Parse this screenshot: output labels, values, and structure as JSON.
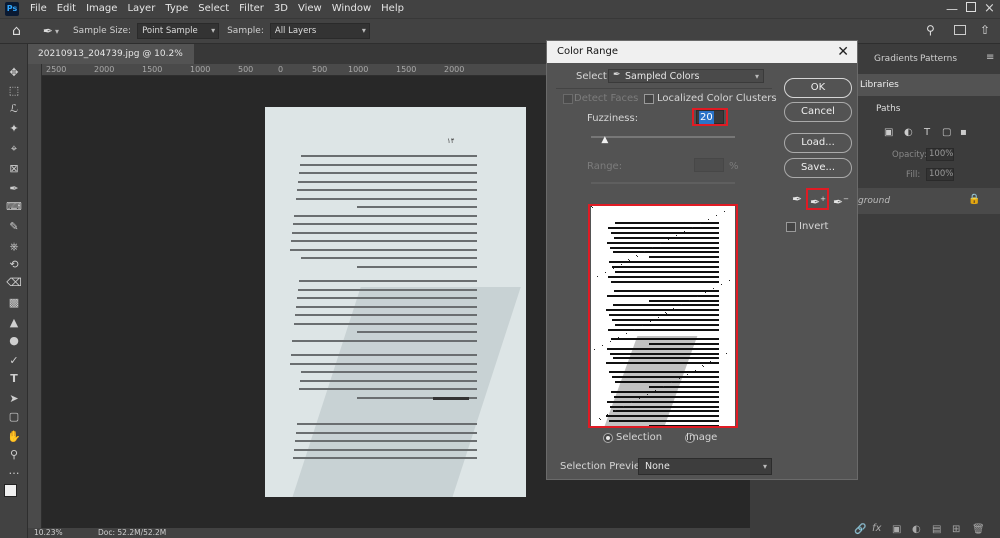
{
  "menubar": {
    "logo": "Ps",
    "items": [
      "File",
      "Edit",
      "Image",
      "Layer",
      "Type",
      "Select",
      "Filter",
      "3D",
      "View",
      "Window",
      "Help"
    ]
  },
  "options_bar": {
    "sample_size_label": "Sample Size:",
    "sample_size_value": "Point Sample",
    "sample_label": "Sample:",
    "sample_value": "All Layers"
  },
  "document": {
    "tab_title": "20210913_204739.jpg @ 10.2% (RGB/8) *",
    "page_number": "۱۴",
    "ruler_marks": [
      "2500",
      "2000",
      "1500",
      "1000",
      "500",
      "0",
      "500",
      "1000",
      "1500",
      "2000"
    ]
  },
  "status_bar": {
    "zoom": "10.23%",
    "doc_info": "Doc: 52.2M/52.2M"
  },
  "right_panel": {
    "tabs": [
      "Gradients",
      "Patterns"
    ],
    "sub_tab_libraries": "Libraries",
    "sub_tab_paths": "Paths",
    "opacity_label": "Opacity:",
    "opacity_value": "100%",
    "fill_label": "Fill:",
    "fill_value": "100%",
    "layer_name": "ground"
  },
  "dialog": {
    "title": "Color Range",
    "select_label": "Select:",
    "select_value": "Sampled Colors",
    "detect_faces_label": "Detect Faces",
    "localized_label": "Localized Color Clusters",
    "fuzziness_label": "Fuzziness:",
    "fuzziness_value": "20",
    "range_label": "Range:",
    "range_unit": "%",
    "radio_selection": "Selection",
    "radio_image": "Image",
    "selection_preview_label": "Selection Preview:",
    "selection_preview_value": "None",
    "ok": "OK",
    "cancel": "Cancel",
    "load": "Load...",
    "save": "Save...",
    "invert": "Invert",
    "fuzziness_slider": 0.1
  }
}
